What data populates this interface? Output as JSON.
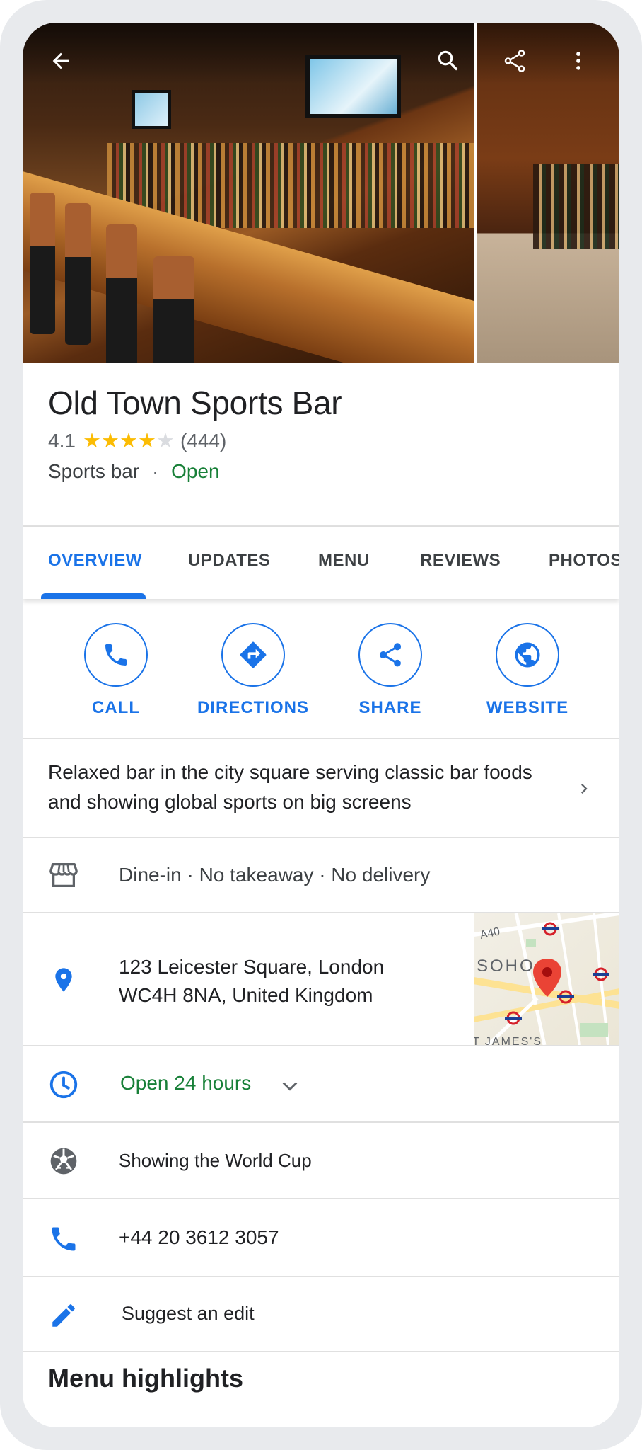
{
  "header": {
    "back_icon": "arrow-back-icon",
    "search_icon": "search-icon",
    "share_icon": "share-icon",
    "more_icon": "more-vert-icon"
  },
  "place": {
    "name": "Old Town Sports Bar",
    "rating": "4.1",
    "rating_value": 4.1,
    "review_count": "(444)",
    "category": "Sports bar",
    "separator": "·",
    "status": "Open"
  },
  "tabs": [
    {
      "label": "OVERVIEW",
      "active": true
    },
    {
      "label": "UPDATES",
      "active": false
    },
    {
      "label": "MENU",
      "active": false
    },
    {
      "label": "REVIEWS",
      "active": false
    },
    {
      "label": "PHOTOS",
      "active": false
    }
  ],
  "actions": [
    {
      "label": "CALL",
      "icon": "phone-icon"
    },
    {
      "label": "DIRECTIONS",
      "icon": "directions-icon"
    },
    {
      "label": "SHARE",
      "icon": "share-icon"
    },
    {
      "label": "WEBSITE",
      "icon": "globe-icon"
    }
  ],
  "description": "Relaxed bar in the city square serving classic bar foods and showing global sports on big screens",
  "service_options": "Dine-in · No takeaway · No delivery",
  "address": {
    "line1": "123 Leicester Square, London",
    "line2": "WC4H 8NA, United Kingdom"
  },
  "map": {
    "road_label": "A40",
    "area_label": "SOHO",
    "area_label_2": "T JAMES'S"
  },
  "hours": "Open 24 hours",
  "feature": "Showing the World Cup",
  "phone": "+44 20 3612 3057",
  "suggest_edit": "Suggest an edit",
  "menu_highlights": "Menu highlights",
  "colors": {
    "accent": "#1a73e8",
    "open_green": "#188038",
    "star": "#fbbc04",
    "pin_red": "#ea4335"
  }
}
